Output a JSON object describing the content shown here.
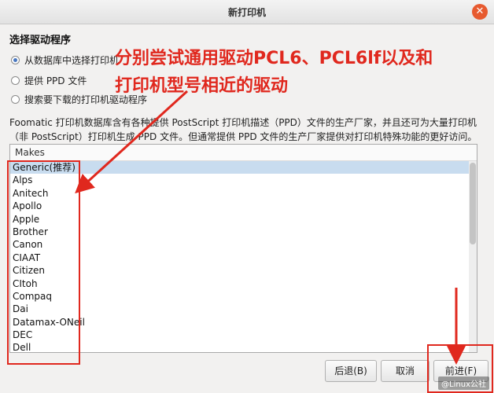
{
  "window": {
    "title": "新打印机",
    "close_icon": "close-icon"
  },
  "section_title": "选择驱动程序",
  "radios": [
    {
      "label": "从数据库中选择打印机",
      "checked": true
    },
    {
      "label": "提供 PPD 文件",
      "checked": false
    },
    {
      "label": "搜索要下载的打印机驱动程序",
      "checked": false
    }
  ],
  "description": "Foomatic 打印机数据库含有各种提供 PostScript 打印机描述（PPD）文件的生产厂家，并且还可为大量打印机（非 PostScript）打印机生成 PPD 文件。但通常提供 PPD 文件的生产厂家提供对打印机特殊功能的更好访问。",
  "makes_list": {
    "header": "Makes",
    "items": [
      "Generic(推荐)",
      "Alps",
      "Anitech",
      "Apollo",
      "Apple",
      "Brother",
      "Canon",
      "CIAAT",
      "Citizen",
      "CItoh",
      "Compaq",
      "Dai",
      "Datamax-ONeil",
      "DEC",
      "Dell"
    ],
    "selected_index": 0
  },
  "buttons": {
    "back": "后退(B)",
    "cancel": "取消",
    "forward": "前进(F)"
  },
  "annotation": {
    "line1": "分别尝试通用驱动PCL6、PCL6lf以及和",
    "line2": "打印机型号相近的驱动",
    "color": "#e0281e"
  },
  "watermark": "@Linux公社"
}
